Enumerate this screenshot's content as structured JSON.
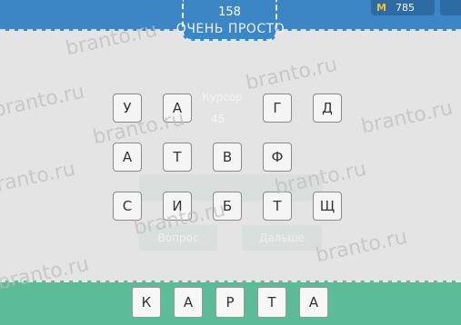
{
  "header": {
    "level": "158",
    "coins": "785",
    "coin_symbol": "M",
    "ghost_title": "ОЧЕНЬ ПРОСТО"
  },
  "ghost": {
    "hint_word": "Курсор",
    "hint_cost": "45",
    "left_button": "Вопрос",
    "right_button": "Дальше"
  },
  "letters": [
    "У",
    "А",
    "Г",
    "Д",
    "А",
    "Т",
    "В",
    "Ф",
    "С",
    "И",
    "Б",
    "Т",
    "Щ"
  ],
  "answer": [
    "К",
    "А",
    "Р",
    "Т",
    "А"
  ],
  "watermark": "branto.ru"
}
